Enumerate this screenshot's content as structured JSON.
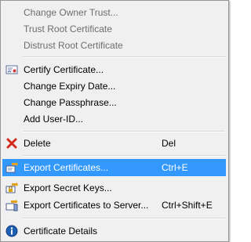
{
  "menu": {
    "change_owner_trust": "Change Owner Trust...",
    "trust_root": "Trust Root Certificate",
    "distrust_root": "Distrust Root Certificate",
    "certify": "Certify Certificate...",
    "change_expiry": "Change Expiry Date...",
    "change_passphrase": "Change Passphrase...",
    "add_user_id": "Add User-ID...",
    "delete": {
      "label": "Delete",
      "shortcut": "Del"
    },
    "export_certificates": {
      "label": "Export Certificates...",
      "shortcut": "Ctrl+E"
    },
    "export_secret_keys": "Export Secret Keys...",
    "export_to_server": {
      "label": "Export Certificates to Server...",
      "shortcut": "Ctrl+Shift+E"
    },
    "certificate_details": "Certificate Details"
  },
  "icons": {
    "certify": "certify-icon",
    "delete": "delete-x-icon",
    "export": "export-certificates-icon",
    "export_secret": "export-secret-keys-icon",
    "export_server": "export-to-server-icon",
    "details": "info-icon"
  },
  "colors": {
    "highlight": "#3399ff",
    "delete_red": "#d42a1e",
    "info_blue": "#1f5fb4"
  }
}
